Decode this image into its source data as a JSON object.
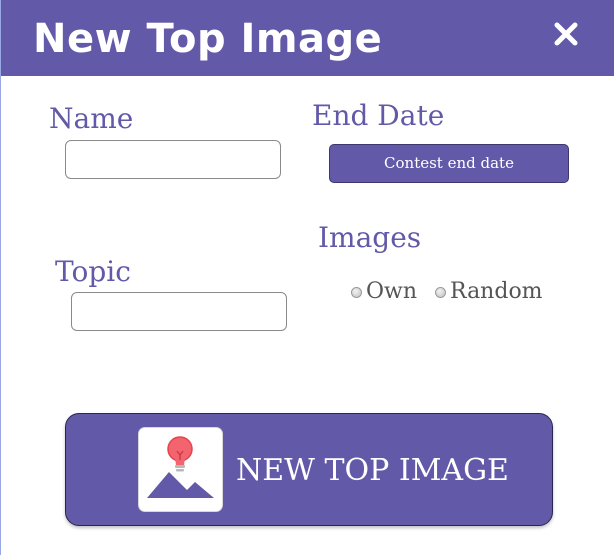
{
  "dialog": {
    "title": "New Top Image",
    "close_icon": "close-icon"
  },
  "form": {
    "name_label": "Name",
    "name_value": "",
    "end_date_label": "End Date",
    "end_date_button": "Contest end date",
    "images_label": "Images",
    "topic_label": "Topic",
    "topic_value": "",
    "images_options": [
      {
        "label": "Own",
        "selected": false
      },
      {
        "label": "Random",
        "selected": false
      }
    ]
  },
  "action": {
    "label": "NEW TOP IMAGE",
    "icon": "lightbulb-image-icon"
  },
  "colors": {
    "accent": "#6259a8",
    "bulb": "#f4646e",
    "text_muted": "#555555"
  }
}
